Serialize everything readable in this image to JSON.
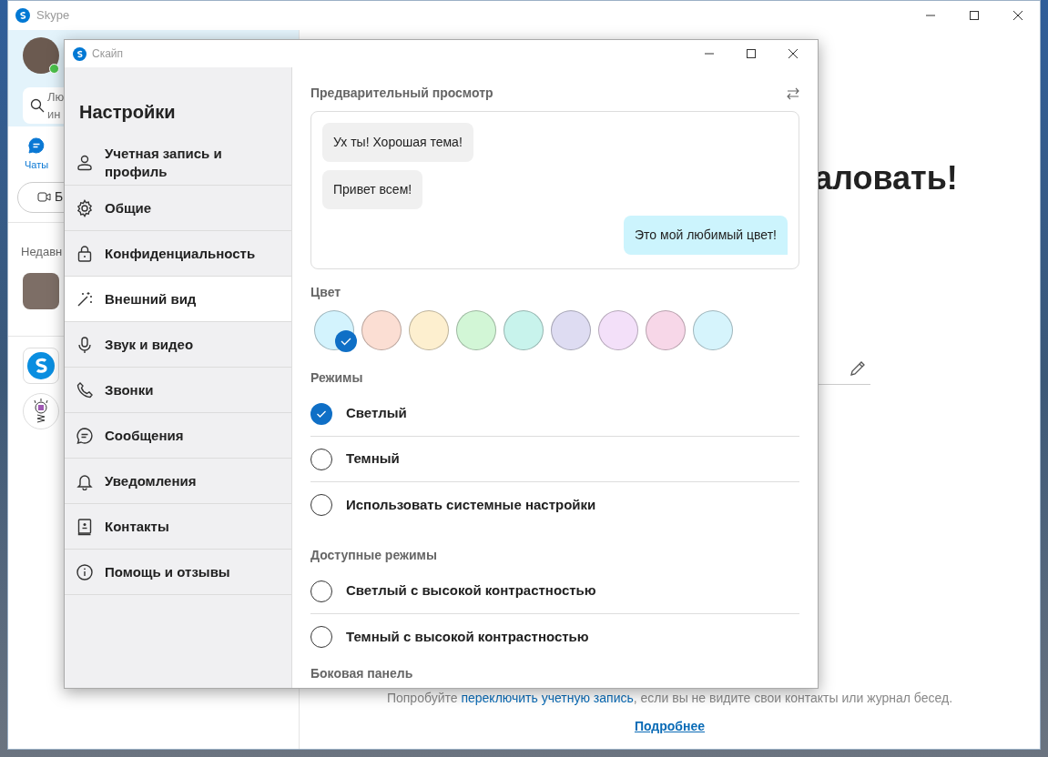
{
  "main_window": {
    "title": "Skype",
    "search": {
      "placeholder_lines": [
        "Лю",
        "ин"
      ]
    },
    "nav_tabs": [
      {
        "label": "Чаты",
        "selected": true
      }
    ],
    "new_button": {
      "label": "Б"
    },
    "recent_heading": "Недавн",
    "recent_chats": [
      {
        "kind": "photo"
      },
      {
        "kind": "logo"
      },
      {
        "kind": "bot"
      }
    ],
    "welcome_heading": "аловать!",
    "hint": {
      "before": "Попробуйте ",
      "link": "переключить учетную запись",
      "after": ", если вы не видите свои контакты или журнал бесед."
    },
    "more_link": "Подробнее"
  },
  "settings_window": {
    "title": "Скайп",
    "heading": "Настройки",
    "items": [
      {
        "kind": "person",
        "label": "Учетная запись и профиль",
        "selected": false
      },
      {
        "kind": "gear",
        "label": "Общие",
        "selected": false
      },
      {
        "kind": "lock",
        "label": "Конфиденциальность",
        "selected": false
      },
      {
        "kind": "wand",
        "label": "Внешний вид",
        "selected": true
      },
      {
        "kind": "mic",
        "label": "Звук и видео",
        "selected": false
      },
      {
        "kind": "phone",
        "label": "Звонки",
        "selected": false
      },
      {
        "kind": "chat",
        "label": "Сообщения",
        "selected": false
      },
      {
        "kind": "bell",
        "label": "Уведомления",
        "selected": false
      },
      {
        "kind": "contacts",
        "label": "Контакты",
        "selected": false
      },
      {
        "kind": "info",
        "label": "Помощь и отзывы",
        "selected": false
      }
    ],
    "preview": {
      "title": "Предварительный просмотр",
      "messages": [
        {
          "text": "Ух ты! Хорошая тема!",
          "outgoing": false
        },
        {
          "text": "Привет всем!",
          "outgoing": false
        },
        {
          "text": "Это мой любимый цвет!",
          "outgoing": true
        }
      ]
    },
    "color_title": "Цвет",
    "colors": [
      {
        "color": "#d3f3fd",
        "selected": true
      },
      {
        "color": "#fbded3",
        "selected": false
      },
      {
        "color": "#fdefcf",
        "selected": false
      },
      {
        "color": "#d2f6d6",
        "selected": false
      },
      {
        "color": "#c8f3ec",
        "selected": false
      },
      {
        "color": "#dedcf2",
        "selected": false
      },
      {
        "color": "#f3e0f9",
        "selected": false
      },
      {
        "color": "#f7d7e8",
        "selected": false
      },
      {
        "color": "#d6f4fc",
        "selected": false
      }
    ],
    "modes_title": "Режимы",
    "modes": [
      {
        "label": "Светлый",
        "selected": true
      },
      {
        "label": "Темный",
        "selected": false
      },
      {
        "label": "Использовать системные настройки",
        "selected": false
      }
    ],
    "available_title": "Доступные режимы",
    "available_modes": [
      {
        "label": "Светлый с высокой контрастностью",
        "selected": false
      },
      {
        "label": "Темный с высокой контрастностью",
        "selected": false
      }
    ],
    "sidebar_title": "Боковая панель"
  }
}
